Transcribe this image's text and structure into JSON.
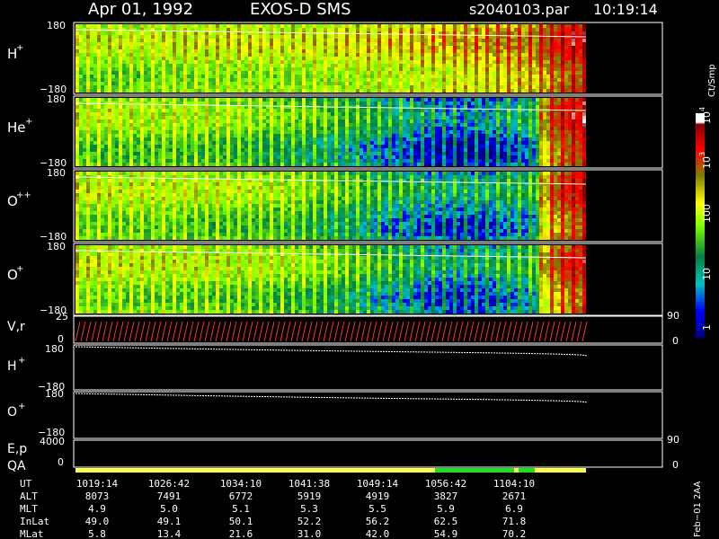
{
  "header": {
    "date": "Apr 01, 1992",
    "instrument": "EXOS-D SMS",
    "file": "s2040103.par",
    "time": "10:19:14"
  },
  "chart_data": {
    "type": "heatmap",
    "panels": [
      {
        "id": "h-plus",
        "label": "H",
        "sup": "+",
        "ytop": "180",
        "ybot": "−180",
        "intensity": [
          30,
          28,
          35,
          40,
          38,
          45,
          60,
          80,
          120,
          200,
          800
        ]
      },
      {
        "id": "he-plus",
        "label": "He",
        "sup": "+",
        "ytop": "180",
        "ybot": "−180",
        "intensity": [
          25,
          22,
          20,
          18,
          12,
          8,
          4,
          2,
          2,
          4,
          900
        ]
      },
      {
        "id": "o-plus-plus",
        "label": "O",
        "sup": "++",
        "ytop": "180",
        "ybot": "−180",
        "intensity": [
          30,
          28,
          25,
          22,
          18,
          10,
          5,
          3,
          3,
          5,
          700
        ]
      },
      {
        "id": "o-plus",
        "label": "O",
        "sup": "+",
        "ytop": "180",
        "ybot": "−180",
        "intensity": [
          35,
          30,
          28,
          25,
          20,
          12,
          6,
          3,
          3,
          6,
          600
        ]
      }
    ],
    "vr_panel": {
      "label": "V,r",
      "ytop": "25",
      "ybot": "0",
      "right_top": "90",
      "right_bot": "0"
    },
    "h_line": {
      "label": "H",
      "sup": "+",
      "ytop": "180",
      "ybot": "−180"
    },
    "o_line": {
      "label": "O",
      "sup": "+",
      "ytop": "180",
      "ybot": "−180"
    },
    "ep_panel": {
      "label": "E,p",
      "ytop": "4000",
      "ybot": "0",
      "right_top": "90",
      "right_bot": "0"
    },
    "qa_label": "QA",
    "colorbar": {
      "unit": "Ct/Smp",
      "ticks": [
        "1",
        "10",
        "100",
        "10",
        "10"
      ],
      "sups": [
        "",
        "",
        "",
        "3",
        "4"
      ],
      "scale": "log",
      "range": [
        1,
        10000
      ]
    },
    "table": {
      "headers": [
        "UT",
        "ALT",
        "MLT",
        "InLat",
        "MLat"
      ],
      "rows": [
        [
          "1019:14",
          "1026:42",
          "1034:10",
          "1041:38",
          "1049:14",
          "1056:42",
          "1104:10"
        ],
        [
          "8073",
          "7491",
          "6772",
          "5919",
          "4919",
          "3827",
          "2671"
        ],
        [
          "4.9",
          "5.0",
          "5.1",
          "5.3",
          "5.5",
          "5.9",
          "6.9"
        ],
        [
          "49.0",
          "49.1",
          "50.1",
          "52.2",
          "56.2",
          "62.5",
          "71.8"
        ],
        [
          "5.8",
          "13.4",
          "21.6",
          "31.0",
          "42.0",
          "54.9",
          "70.2"
        ]
      ]
    },
    "footer": "Feb−01 2AA"
  },
  "colors": {
    "background": "#000000",
    "axis": "#ffffff",
    "qa_ok": "#ffff55",
    "qa_alt": "#22dd22",
    "vr_trace": "#ff3333"
  }
}
